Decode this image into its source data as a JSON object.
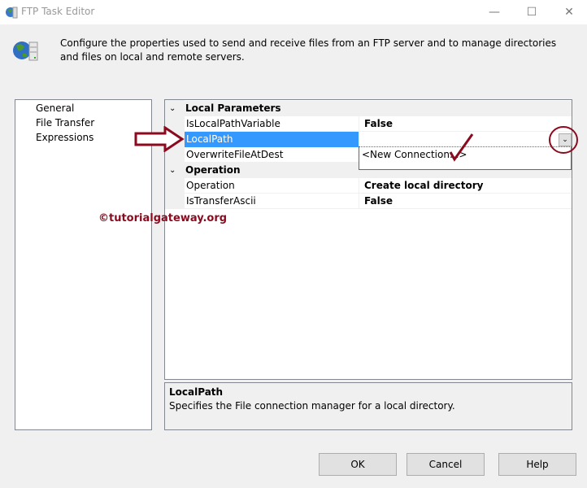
{
  "window": {
    "title": "FTP Task Editor",
    "minimize": "—",
    "maximize": "☐",
    "close": "✕"
  },
  "header": {
    "description": "Configure the properties used to send and receive files from an FTP server and to manage directories and files on local and remote servers."
  },
  "sidebar": {
    "items": [
      {
        "label": "General"
      },
      {
        "label": "File Transfer"
      },
      {
        "label": "Expressions"
      }
    ]
  },
  "grid": {
    "categories": [
      {
        "label": "Local Parameters"
      },
      {
        "label": "Operation"
      }
    ],
    "rows": [
      {
        "name": "IsLocalPathVariable",
        "value": "False"
      },
      {
        "name": "LocalPath",
        "value": ""
      },
      {
        "name": "OverwriteFileAtDest",
        "value": ""
      },
      {
        "name": "Operation",
        "value": "Create local directory"
      },
      {
        "name": "IsTransferAscii",
        "value": "False"
      }
    ],
    "dropdown_option": "<New Connection...>"
  },
  "help": {
    "title": "LocalPath",
    "text": "Specifies the File connection manager for a local directory."
  },
  "watermark": "©tutorialgateway.org",
  "buttons": {
    "ok": "OK",
    "cancel": "Cancel",
    "help": "Help"
  },
  "colors": {
    "selection": "#3399ff",
    "annotation": "#8b0a1e"
  }
}
